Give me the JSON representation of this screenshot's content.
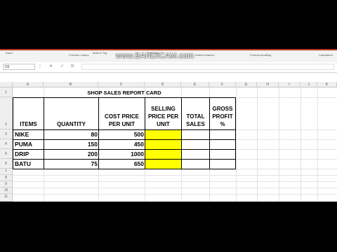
{
  "ribbon": {
    "groups": [
      "Function Library",
      "Defined Names",
      "Formula Auditing",
      "Calculation"
    ],
    "top_labels": [
      "Insert",
      "Math & Trig",
      "Formulas"
    ]
  },
  "watermark": "www.BANDICAM.com",
  "formula_bar": {
    "name_box": "D5",
    "cancel_icon": "✕",
    "enter_icon": "✓",
    "fx_label": "fx",
    "formula": ""
  },
  "columns": [
    "A",
    "B",
    "C",
    "D",
    "E",
    "F",
    "G",
    "H",
    "I",
    "J",
    "K"
  ],
  "rows": [
    "1",
    "2",
    "3",
    "4",
    "5",
    "6",
    "7",
    "8",
    "9",
    "10",
    "11"
  ],
  "table": {
    "title": "SHOP SALES REPORT CARD",
    "headers": [
      "ITEMS",
      "QUANTITY",
      "COST PRICE PER UNIT",
      "SELLING PRICE PER UNIT",
      "TOTAL SALES",
      "GROSS PROFIT %"
    ],
    "rows": [
      {
        "item": "NIKE",
        "quantity": "80",
        "cost": "500"
      },
      {
        "item": "PUMA",
        "quantity": "150",
        "cost": "450"
      },
      {
        "item": "DRIP",
        "quantity": "200",
        "cost": "1000"
      },
      {
        "item": "BATU",
        "quantity": "75",
        "cost": "650"
      }
    ]
  },
  "colors": {
    "highlight": "#ffff00",
    "ribbon_accent": "#c0392b"
  }
}
